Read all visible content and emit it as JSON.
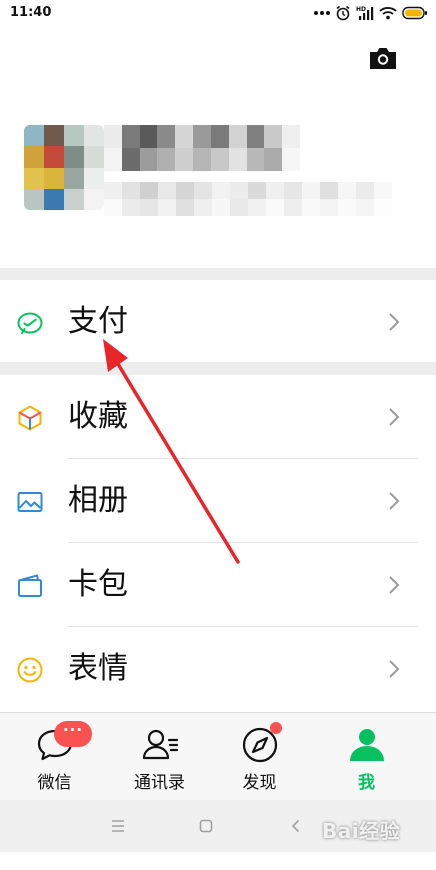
{
  "status_bar": {
    "time": "11:40",
    "icons": [
      "more-dots-icon",
      "alarm-icon",
      "hd-signal-icon",
      "wifi-icon",
      "battery-icon"
    ]
  },
  "header": {
    "camera_icon": "camera-icon"
  },
  "profile": {
    "avatar": "blurred-avatar",
    "nickname": "",
    "wechat_id": ""
  },
  "menu": {
    "items": [
      {
        "label": "支付",
        "icon": "pay-icon",
        "color": "#07c160"
      },
      {
        "label": "收藏",
        "icon": "favorites-cube-icon",
        "color": "#f7b500"
      },
      {
        "label": "相册",
        "icon": "photo-album-icon",
        "color": "#2f8ad8"
      },
      {
        "label": "卡包",
        "icon": "card-wallet-icon",
        "color": "#2f8ad8"
      },
      {
        "label": "表情",
        "icon": "smiley-sticker-icon",
        "color": "#f7b500"
      }
    ]
  },
  "annotation": {
    "arrow_color": "#e8262a"
  },
  "tab_bar": {
    "tabs": [
      {
        "label": "微信",
        "icon": "chat-bubble-icon",
        "badge": "···"
      },
      {
        "label": "通讯录",
        "icon": "contacts-icon"
      },
      {
        "label": "发现",
        "icon": "compass-icon"
      },
      {
        "label": "我",
        "icon": "person-icon",
        "active": true
      }
    ],
    "active_color": "#07c160",
    "badge_color": "#fa5151"
  },
  "system_nav": {
    "buttons": [
      "menu-lines-icon",
      "home-square-icon",
      "back-chevron-icon"
    ]
  },
  "watermark": {
    "text": "Bai经验"
  }
}
